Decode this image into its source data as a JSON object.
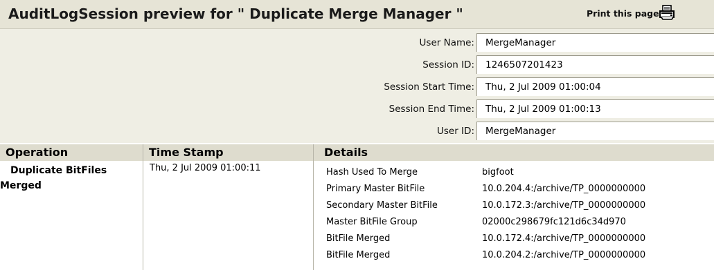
{
  "header": {
    "title": "AuditLogSession preview for \" Duplicate Merge Manager \"",
    "print_label": "Print this page"
  },
  "session": [
    {
      "label": "User Name:",
      "value": "MergeManager"
    },
    {
      "label": "Session ID:",
      "value": "1246507201423"
    },
    {
      "label": "Session Start Time:",
      "value": "Thu, 2 Jul 2009 01:00:04"
    },
    {
      "label": "Session End Time:",
      "value": "Thu, 2 Jul 2009 01:00:13"
    },
    {
      "label": "User ID:",
      "value": "MergeManager"
    }
  ],
  "table": {
    "columns": [
      "Operation",
      "Time Stamp",
      "Details"
    ],
    "operation": "Duplicate BitFiles Merged",
    "timestamp": "Thu, 2 Jul 2009 01:00:11",
    "details": [
      {
        "key": "Hash Used To Merge",
        "value": "bigfoot"
      },
      {
        "key": "Primary Master BitFile",
        "value": "10.0.204.4:/archive/TP_0000000000"
      },
      {
        "key": "Secondary Master BitFile",
        "value": "10.0.172.3:/archive/TP_0000000000"
      },
      {
        "key": "Master BitFile Group",
        "value": "02000c298679fc121d6c34d970"
      },
      {
        "key": "BitFile Merged",
        "value": "10.0.172.4:/archive/TP_0000000000"
      },
      {
        "key": "BitFile Merged",
        "value": "10.0.204.2:/archive/TP_0000000000"
      }
    ]
  }
}
